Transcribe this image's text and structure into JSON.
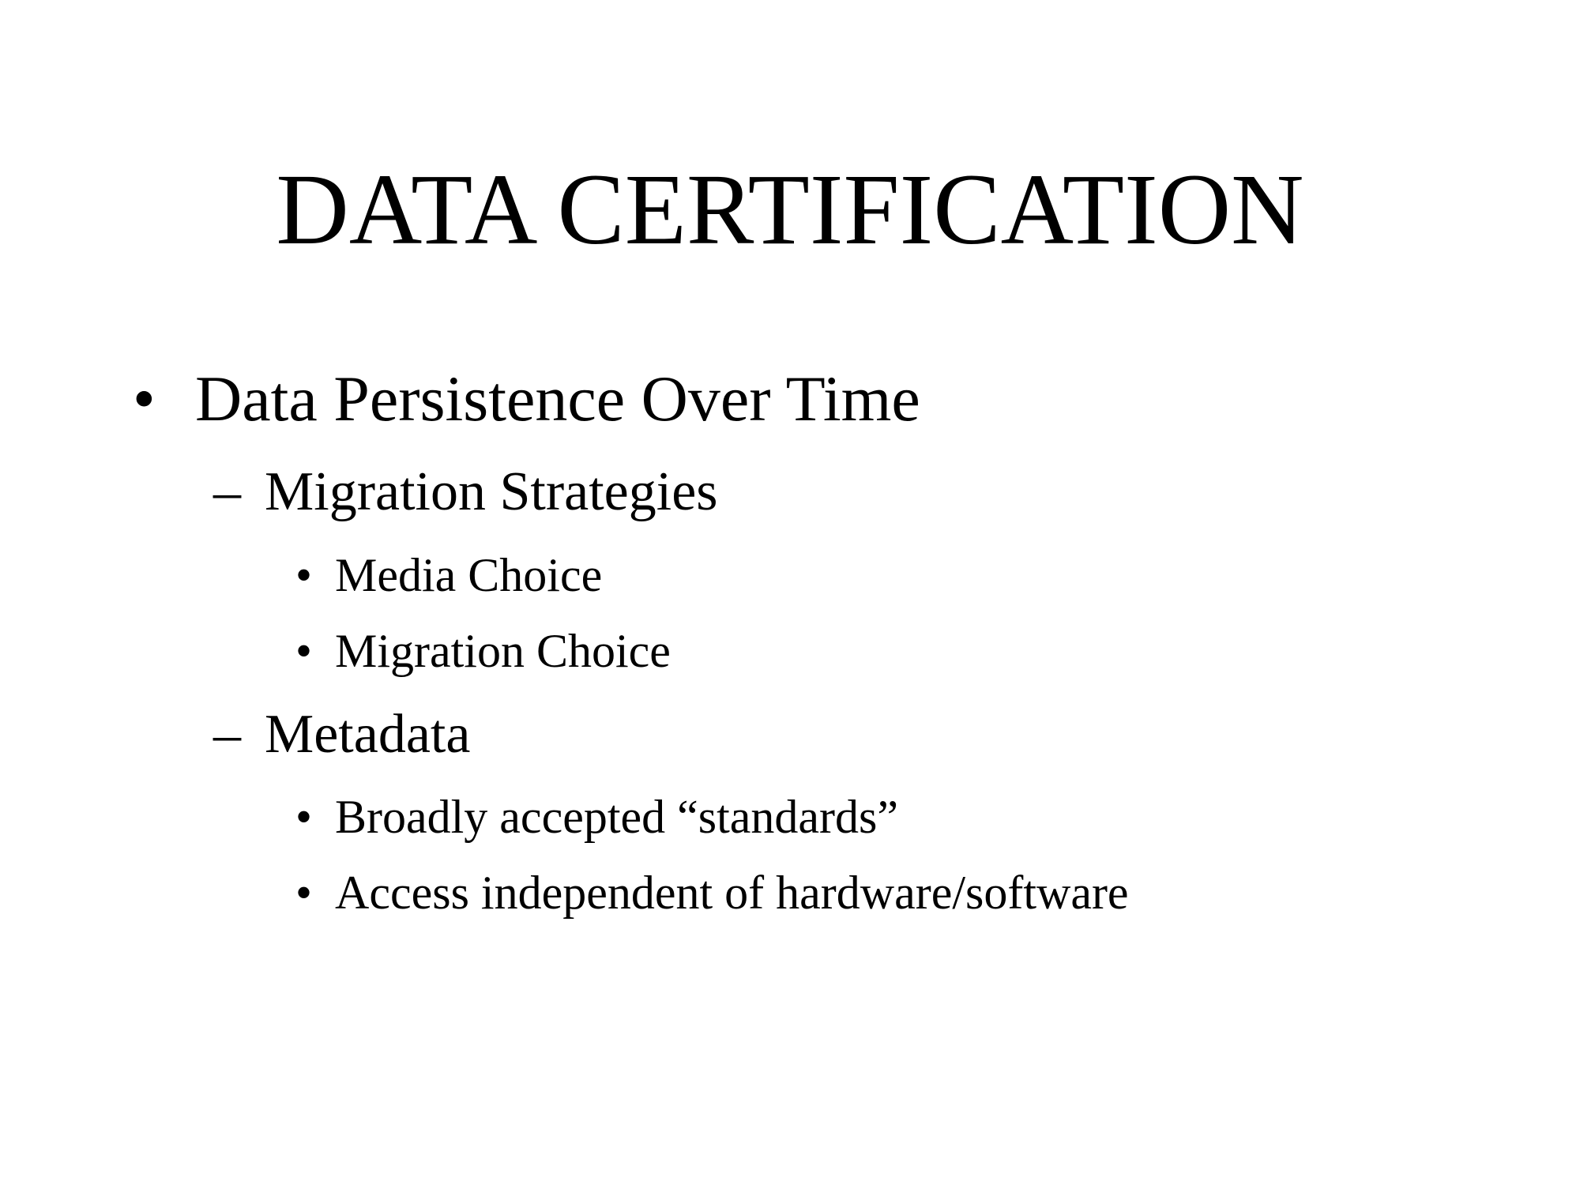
{
  "slide": {
    "title": "DATA CERTIFICATION",
    "bullets": [
      {
        "marker": "•",
        "text": "Data Persistence Over Time",
        "children": [
          {
            "marker": "–",
            "text": "Migration Strategies",
            "children": [
              {
                "marker": "•",
                "text": "Media Choice"
              },
              {
                "marker": "•",
                "text": "Migration Choice"
              }
            ]
          },
          {
            "marker": "–",
            "text": "Metadata",
            "children": [
              {
                "marker": "•",
                "text": "Broadly accepted “standards”"
              },
              {
                "marker": "•",
                "text": "Access independent of hardware/software"
              }
            ]
          }
        ]
      }
    ]
  }
}
